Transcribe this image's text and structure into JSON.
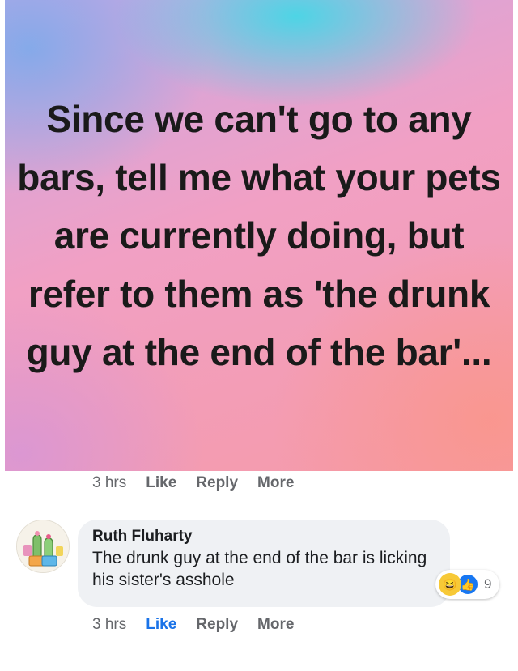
{
  "post": {
    "text": "Since we can't go to any bars, tell me what your pets are currently doing, but refer to them as 'the drunk guy at the end of the bar'...",
    "actions": {
      "time": "3 hrs",
      "like": "Like",
      "reply": "Reply",
      "more": "More"
    }
  },
  "comment": {
    "author": "Ruth Fluharty",
    "text": "The drunk guy at the end of the bar is licking his sister's asshole",
    "reactions": {
      "icons": [
        "haha-icon",
        "like-icon"
      ],
      "count": "9"
    },
    "actions": {
      "time": "3 hrs",
      "like": "Like",
      "reply": "Reply",
      "more": "More"
    },
    "like_color": "#1a73e8"
  }
}
